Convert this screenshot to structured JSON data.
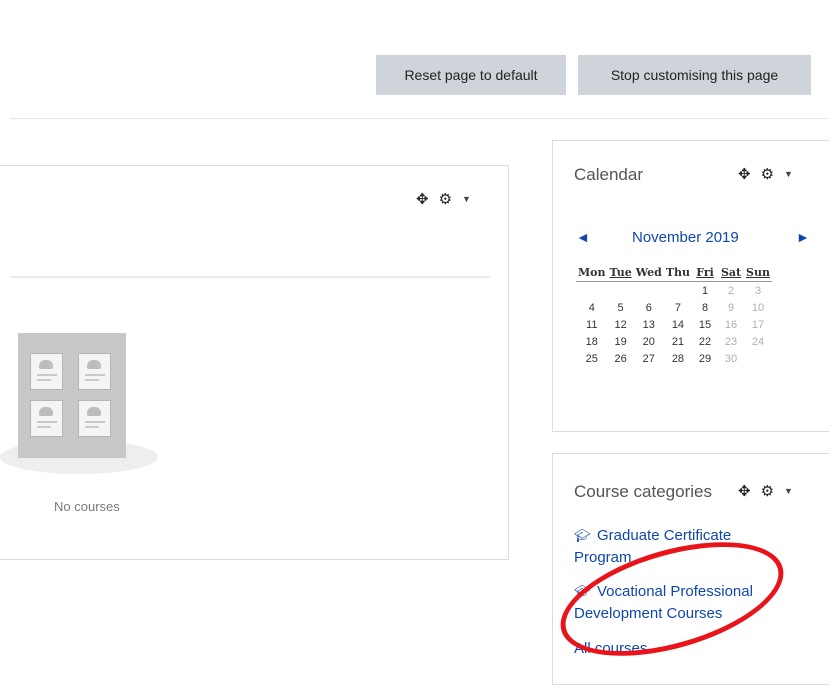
{
  "header": {
    "reset_label": "Reset page to default",
    "stop_label": "Stop customising this page"
  },
  "main_block": {
    "empty_text": "No courses"
  },
  "calendar": {
    "title": "Calendar",
    "month": "November 2019",
    "prev_arrow": "◄",
    "next_arrow": "►",
    "days": [
      "Mon",
      "Tue",
      "Wed",
      "Thu",
      "Fri",
      "Sat",
      "Sun"
    ],
    "weeks": [
      [
        "",
        "",
        "",
        "",
        "1",
        "2",
        "3"
      ],
      [
        "4",
        "5",
        "6",
        "7",
        "8",
        "9",
        "10"
      ],
      [
        "11",
        "12",
        "13",
        "14",
        "15",
        "16",
        "17"
      ],
      [
        "18",
        "19",
        "20",
        "21",
        "22",
        "23",
        "24"
      ],
      [
        "25",
        "26",
        "27",
        "28",
        "29",
        "30",
        ""
      ]
    ]
  },
  "course_categories": {
    "title": "Course categories",
    "items": [
      {
        "label": "Graduate Certificate Program"
      },
      {
        "label": "Vocational Professional Development Courses"
      }
    ],
    "all_courses": "All courses"
  },
  "icons": {
    "move": "move-icon",
    "gear": "gear-icon",
    "caret": "caret-down-icon",
    "graduation_cap": "graduation-cap-icon"
  },
  "colors": {
    "link": "#0f47ad",
    "button_bg": "#ced4da",
    "annotation": "#e8141a"
  }
}
